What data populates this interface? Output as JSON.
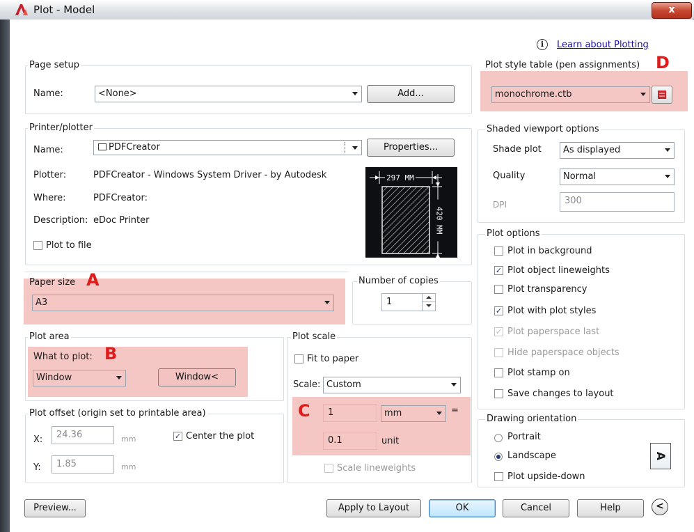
{
  "window": {
    "title": "Plot - Model",
    "close_glyph": "x"
  },
  "header": {
    "info_glyph": "i",
    "learn_link": "Learn about Plotting"
  },
  "page_setup": {
    "group": "Page setup",
    "name_label": "Name:",
    "name_value": "<None>",
    "add_button": "Add..."
  },
  "printer": {
    "group": "Printer/plotter",
    "name_label": "Name:",
    "name_value": "PDFCreator",
    "properties_button": "Properties...",
    "plotter_label": "Plotter:",
    "plotter_value": "PDFCreator - Windows System Driver - by Autodesk",
    "where_label": "Where:",
    "where_value": "PDFCreator:",
    "description_label": "Description:",
    "description_value": "eDoc Printer",
    "plot_to_file": "Plot to file",
    "preview_width": "297 MM",
    "preview_height": "420 MM"
  },
  "paper_size": {
    "group": "Paper size",
    "value": "A3",
    "marker": "A"
  },
  "copies": {
    "group": "Number of copies",
    "value": "1"
  },
  "plot_area": {
    "group": "Plot area",
    "what_label": "What to plot:",
    "marker": "B",
    "value": "Window",
    "window_button": "Window<"
  },
  "plot_scale": {
    "group": "Plot scale",
    "fit_to_paper": "Fit to paper",
    "scale_label": "Scale:",
    "scale_value": "Custom",
    "marker": "C",
    "value1": "1",
    "unit1": "mm",
    "equals": "=",
    "value2": "0.1",
    "unit2": "unit",
    "scale_lineweights": "Scale lineweights"
  },
  "plot_offset": {
    "group": "Plot offset (origin set to printable area)",
    "x_label": "X:",
    "x_value": "24.36",
    "x_unit": "mm",
    "y_label": "Y:",
    "y_value": "1.85",
    "y_unit": "mm",
    "center_plot": "Center the plot"
  },
  "plot_style": {
    "group": "Plot style table (pen assignments)",
    "marker": "D",
    "value": "monochrome.ctb"
  },
  "shaded": {
    "group": "Shaded viewport options",
    "shade_label": "Shade plot",
    "shade_value": "As displayed",
    "quality_label": "Quality",
    "quality_value": "Normal",
    "dpi_label": "DPI",
    "dpi_value": "300"
  },
  "plot_options": {
    "group": "Plot options",
    "items": [
      {
        "label": "Plot in background",
        "checked": false,
        "disabled": false
      },
      {
        "label": "Plot object lineweights",
        "checked": true,
        "disabled": false
      },
      {
        "label": "Plot transparency",
        "checked": false,
        "disabled": false
      },
      {
        "label": "Plot with plot styles",
        "checked": true,
        "disabled": false
      },
      {
        "label": "Plot paperspace last",
        "checked": true,
        "disabled": true
      },
      {
        "label": "Hide paperspace objects",
        "checked": false,
        "disabled": true
      },
      {
        "label": "Plot stamp on",
        "checked": false,
        "disabled": false
      },
      {
        "label": "Save changes to layout",
        "checked": false,
        "disabled": false
      }
    ]
  },
  "orientation": {
    "group": "Drawing orientation",
    "portrait": "Portrait",
    "landscape": "Landscape",
    "upside_down": "Plot upside-down",
    "icon_glyph": "A"
  },
  "footer": {
    "preview": "Preview...",
    "apply": "Apply to Layout",
    "ok": "OK",
    "cancel": "Cancel",
    "help": "Help",
    "collapse_glyph": "<"
  },
  "colors": {
    "highlight": "#f4c7c5",
    "marker": "#e01b1b",
    "link": "#1a0dab"
  }
}
